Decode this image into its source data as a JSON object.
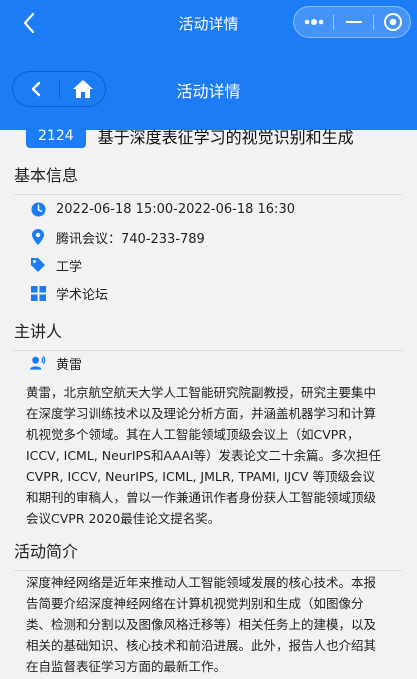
{
  "window": {
    "title": "活动详情"
  },
  "nav": {
    "title": "活动详情"
  },
  "activity": {
    "id": "2124",
    "title": "基于深度表征学习的视觉识别和生成"
  },
  "basic_info": {
    "heading": "基本信息",
    "time": "2022-06-18 15:00-2022-06-18 16:30",
    "location": "腾讯会议：740-233-789",
    "category": "工学",
    "type": "学术论坛"
  },
  "speaker": {
    "heading": "主讲人",
    "name": "黄雷",
    "bio_lines": [
      "黄雷，北京航空航天大学人工智能研究院副教授，研究主要集中",
      "在深度学习训练技术以及理论分析方面，并涵盖机器学习和计算",
      "机视觉多个领域。其在人工智能领域顶级会议上（如CVPR，",
      "ICCV, ICML, NeurIPS和AAAI等）发表论文二十余篇。多次担任",
      "CVPR, ICCV, NeurIPS, ICML, JMLR, TPAMI, IJCV 等顶级会议",
      "和期刊的审稿人，曾以一作兼通讯作者身份获人工智能领域顶级",
      "会议CVPR 2020最佳论文提名奖。"
    ]
  },
  "intro": {
    "heading": "活动简介",
    "lines": [
      "深度神经网络是近年来推动人工智能领域发展的核心技术。本报",
      "告简要介绍深度神经网络在计算机视觉判别和生成（如图像分",
      "类、检测和分割以及图像风格迁移等）相关任务上的建模，以及",
      "相关的基础知识、核心技术和前沿进展。此外，报告人也介绍其",
      "在自监督表征学习方面的最新工作。"
    ]
  },
  "colors": {
    "accent": "#1b7cf5",
    "background": "#f2f2f2"
  }
}
